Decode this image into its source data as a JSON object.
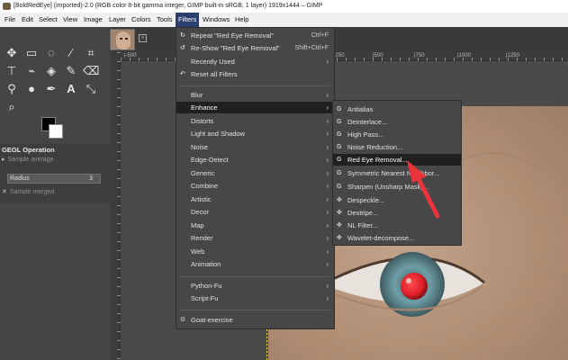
{
  "window": {
    "title": "[BoldRedEye] (imported)-2.0 (RGB color 8-bit gamma integer, GIMP built-in sRGB, 1 layer) 1919x1444 – GIMP"
  },
  "menubar": {
    "items": [
      "File",
      "Edit",
      "Select",
      "View",
      "Image",
      "Layer",
      "Colors",
      "Tools",
      "Filters",
      "Windows",
      "Help"
    ],
    "active": "Filters"
  },
  "tool_options": {
    "title": "GEGL Operation",
    "sample_average": "Sample average",
    "radius_label": "Radius",
    "radius_value": "3",
    "sample_merged": "Sample merged"
  },
  "ruler": {
    "labels": [
      "|-500",
      "|250",
      "|500",
      "|750",
      "|1000",
      "|1250"
    ]
  },
  "filters_menu": {
    "repeat_label": "Repeat \"Red Eye Removal\"",
    "repeat_shortcut": "Ctrl+F",
    "reshow_label": "Re-Show \"Red Eye Removal\"",
    "reshow_shortcut": "Shift+Ctrl+F",
    "recently_used": "Recently Used",
    "reset_all": "Reset all Filters",
    "categories": [
      "Blur",
      "Enhance",
      "Distorts",
      "Light and Shadow",
      "Noise",
      "Edge-Detect",
      "Generic",
      "Combine",
      "Artistic",
      "Decor",
      "Map",
      "Render",
      "Web",
      "Animation"
    ],
    "highlighted": "Enhance",
    "python_fu": "Python-Fu",
    "script_fu": "Script-Fu",
    "goat_exercise": "Goat-exercise"
  },
  "enhance_menu": {
    "items": [
      "Antialias",
      "Deinterlace...",
      "High Pass...",
      "Noise Reduction...",
      "Red Eye Removal...",
      "Symmetric Nearest Neighbor...",
      "Sharpen (Unsharp Mask)...",
      "Despeckle...",
      "Destripe...",
      "NL Filter...",
      "Wavelet-decompose..."
    ],
    "highlighted": "Red Eye Removal...",
    "gegl_icon": "G"
  },
  "colors": {
    "accent_menu": "#2c3e6b",
    "menu_bg": "#474747",
    "highlight_bg": "#202020",
    "pointer_arrow": "#e8343a",
    "red_pupil": "#e0202a",
    "iris": "#6f9ea6"
  }
}
